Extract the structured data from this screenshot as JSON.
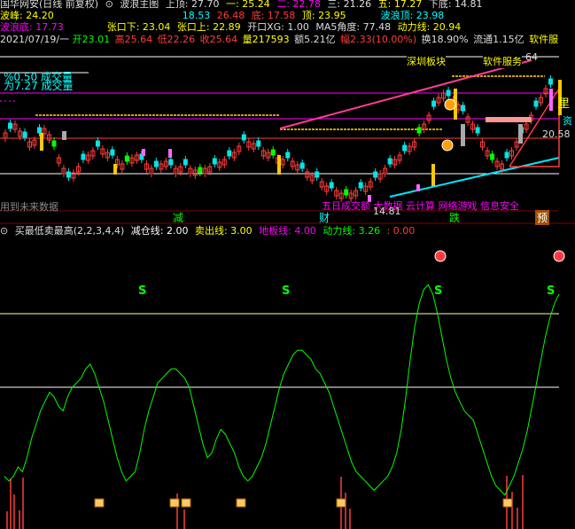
{
  "header": {
    "title": "国华网安(日线 前复权)",
    "main_chart": "波浪主图",
    "top": "上顶: 27.70",
    "one": "一: 25.24",
    "two": "二: 22.78",
    "three": "三: 21.26",
    "five": "五: 17.27",
    "low_bottom": "下底: 14.81",
    "bodi": "波峰: 24.20",
    "v1": "18.53",
    "v2": "26.48",
    "bottom": "底: 17.58",
    "peak": "顶: 23.95",
    "wave_peak": "波浪顶: 23.98",
    "wave_bottom": "波浪底: 17.73",
    "gap_down": "张口下: 23.04",
    "gap_up": "张口上: 22.89",
    "open_xg": "开口XG: 1.00",
    "ma5_angle": "MA5角度: 77.48",
    "power_line": "动力线: 20.94",
    "date": "2021/07/19/一",
    "open": "开23.01",
    "high": "高25.64",
    "low": "低22.26",
    "close": "收25.64",
    "volume": "量217593",
    "amount": "额5.21亿",
    "change": "幅2.33(10.00%)",
    "turnover": "换18.90%",
    "float": "流通1.15亿",
    "sector": "软件服"
  },
  "overlay": {
    "volume_ratio": "%0.50 成交量",
    "volume_label": "为7.27 成交量",
    "future_data": "用到未来数据",
    "sz_board": "深圳板块",
    "soft_service": "软件服务",
    "price_right": "20.58",
    "price_top": "64",
    "price_low": "14.81",
    "marquee": "五日成交额  大数据  云计算  网络游戏  信息安全",
    "reduce_mark": "减",
    "wealth_mark": "财",
    "fall_mark": "跌",
    "warn_mark": "预",
    "li_mark": "里",
    "right_edge": "资"
  },
  "indicator": {
    "name": "买最低卖最高(2,2,3,4,4)",
    "reduce_line": "减仓线: 2.00",
    "sell_line": "卖出线: 3.00",
    "floor_line": "地板线: 4.00",
    "power_line": "动力线: 3.26",
    "extra": ": 0.00",
    "s_label": "S"
  },
  "colors": {
    "up": "#ff3c3c",
    "down": "#00e6e6",
    "yellow": "#ffff00",
    "magenta": "#ff00ff",
    "green": "#00ff00",
    "cyan": "#00ffff",
    "orange": "#ffa000"
  },
  "chart_data": {
    "type": "line",
    "series": [
      {
        "values": [
          0.9,
          0.8,
          0.9,
          1.1,
          1.0,
          1.3,
          1.7,
          2.0,
          2.3,
          2.5,
          2.7,
          2.6,
          2.4,
          2.3,
          2.6,
          2.8,
          2.9,
          3.0,
          3.2,
          3.3,
          3.1,
          2.8,
          2.5,
          2.1,
          1.7,
          1.3,
          1.0,
          0.8,
          0.9,
          1.0,
          1.4,
          1.9,
          2.3,
          2.6,
          2.9,
          3.0,
          3.1,
          3.2,
          3.2,
          3.1,
          3.0,
          2.8,
          2.4,
          2.0,
          1.6,
          1.3,
          1.4,
          1.7,
          1.9,
          1.8,
          1.6,
          1.4,
          1.1,
          0.9,
          0.8,
          0.9,
          1.1,
          1.3,
          1.6,
          2.0,
          2.4,
          2.8,
          3.1,
          3.3,
          3.5,
          3.6,
          3.6,
          3.5,
          3.4,
          3.2,
          3.1,
          2.9,
          2.7,
          2.4,
          2.1,
          1.8,
          1.5,
          1.2,
          1.0,
          0.9,
          0.8,
          0.7,
          0.6,
          0.7,
          0.8,
          0.9,
          1.1,
          1.4,
          1.9,
          2.6,
          3.4,
          4.1,
          4.6,
          4.9,
          5.0,
          4.8,
          4.4,
          3.9,
          3.4,
          3.0,
          2.7,
          2.5,
          2.3,
          2.2,
          2.1,
          1.8,
          1.5,
          1.2,
          0.9,
          0.7,
          0.6,
          0.5,
          0.7,
          0.9,
          1.2,
          1.5,
          1.9,
          2.4,
          2.9,
          3.4,
          3.9,
          4.3,
          4.6,
          4.8
        ]
      }
    ],
    "ylim": [
      0,
      5.5
    ],
    "grid": false
  }
}
